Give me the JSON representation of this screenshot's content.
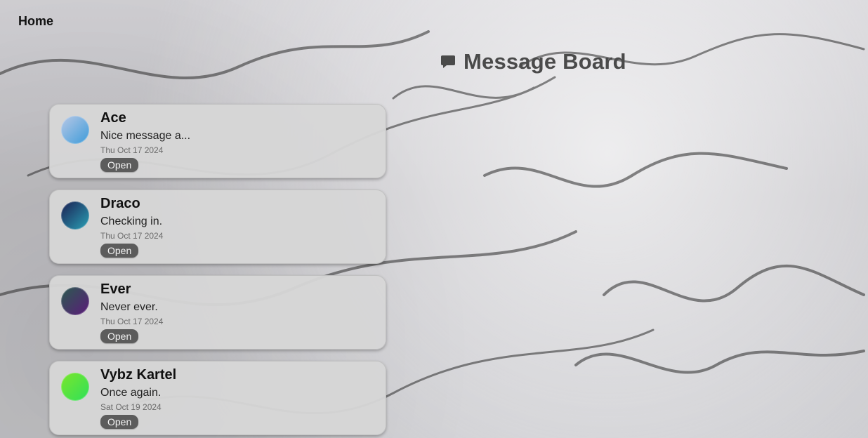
{
  "nav": {
    "home_label": "Home"
  },
  "header": {
    "title": "Message Board",
    "icon": "message-icon"
  },
  "threads": [
    {
      "name": "Ace",
      "message": "Nice message a...",
      "date": "Thu Oct 17 2024",
      "button_label": "Open",
      "avatar_colors": [
        "#b8c8e6",
        "#3d9bd9"
      ]
    },
    {
      "name": "Draco",
      "message": "Checking in.",
      "date": "Thu Oct 17 2024",
      "button_label": "Open",
      "avatar_colors": [
        "#1b1f52",
        "#2aa1b6"
      ]
    },
    {
      "name": "Ever",
      "message": "Never ever.",
      "date": "Thu Oct 17 2024",
      "button_label": "Open",
      "avatar_colors": [
        "#2b5b4f",
        "#5b1b7a"
      ]
    },
    {
      "name": "Vybz Kartel",
      "message": "Once again.",
      "date": "Sat Oct 19 2024",
      "button_label": "Open",
      "avatar_colors": [
        "#7be62b",
        "#2fe05a"
      ]
    }
  ]
}
